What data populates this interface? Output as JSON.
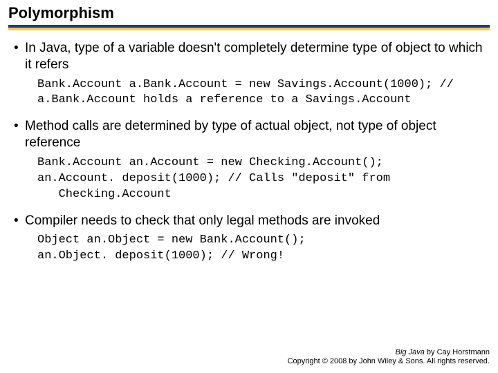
{
  "title": "Polymorphism",
  "bullets": [
    {
      "text": "In Java, type of a variable doesn't completely determine type of object to which it refers",
      "code": "Bank.Account a.Bank.Account = new Savings.Account(1000); // a.Bank.Account holds a reference to a Savings.Account"
    },
    {
      "text": "Method calls are determined by type of actual object, not type of object reference",
      "code": "Bank.Account an.Account = new Checking.Account();\nan.Account. deposit(1000); // Calls \"deposit\" from\n   Checking.Account"
    },
    {
      "text": "Compiler needs to check that only legal methods are invoked",
      "code": "Object an.Object = new Bank.Account();\nan.Object. deposit(1000); // Wrong!"
    }
  ],
  "footer": {
    "book": "Big Java",
    "author": " by Cay Horstmann",
    "copyright": "Copyright © 2008 by John Wiley & Sons. All rights reserved."
  }
}
